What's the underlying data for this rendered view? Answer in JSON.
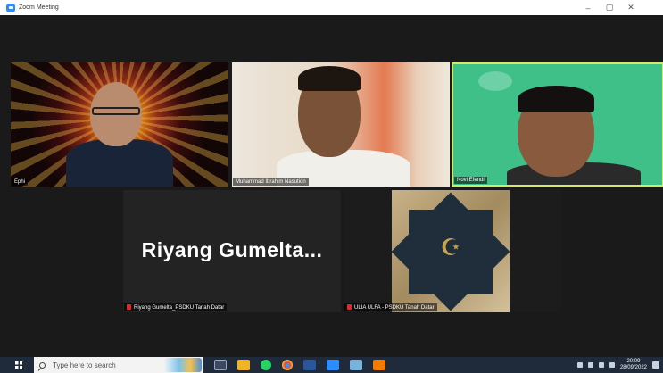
{
  "window": {
    "title": "Zoom Meeting",
    "controls": [
      "–",
      "▢",
      "✕"
    ]
  },
  "participants": [
    {
      "name": "Ephi",
      "muted": false
    },
    {
      "name": "Muhammad Ibrahim Nasution",
      "muted": false
    },
    {
      "name": "Novi Efendi",
      "muted": false,
      "active_speaker": true
    },
    {
      "name": "Riyang Gumelta_PSDKU Tanah Datar",
      "muted": true,
      "display_name_large": "Riyang  Gumelta..."
    },
    {
      "name": "ULIA ULFA - PSDKU Tanah Datar",
      "muted": true
    }
  ],
  "taskbar": {
    "search_placeholder": "Type here to search",
    "clock_time": "20:09",
    "clock_date": "28/09/2022"
  },
  "colors": {
    "active_border": "#d6e86a",
    "mute_red": "#e02828",
    "zoom_blue": "#2d8cff",
    "taskbar": "#1f2a3a"
  }
}
